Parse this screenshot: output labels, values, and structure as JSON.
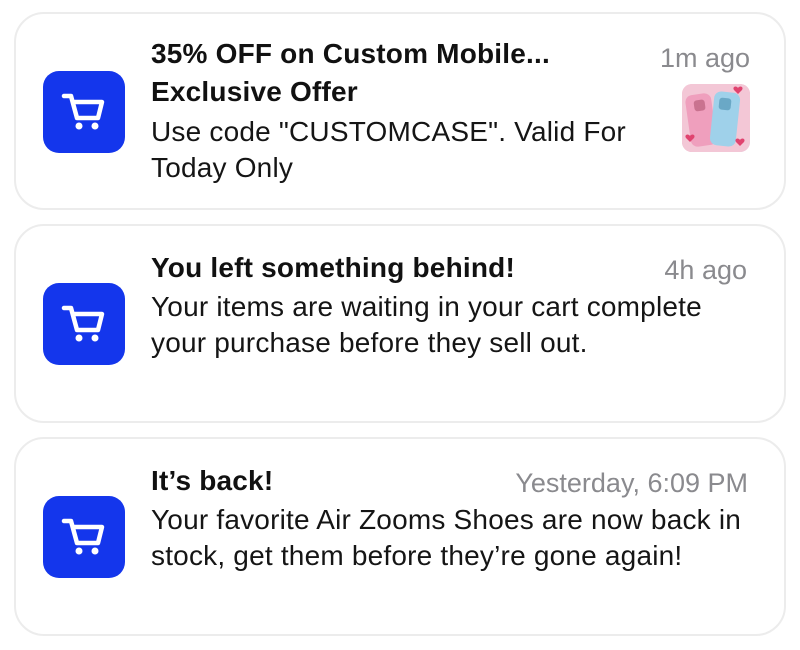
{
  "notifications": [
    {
      "app_icon": "shopping-cart-icon",
      "title": "35% OFF on Custom Mobile...",
      "subtitle": "Exclusive Offer",
      "body": "Use code \"CUSTOMCASE\". Valid For Today Only",
      "time": "1m ago",
      "thumbnail": "phone-cases-image"
    },
    {
      "app_icon": "shopping-cart-icon",
      "title": "You left something behind!",
      "body": "Your items are waiting in your cart complete your purchase before they sell out.",
      "time": "4h ago"
    },
    {
      "app_icon": "shopping-cart-icon",
      "title": "It’s back!",
      "body": "Your favorite Air Zooms Shoes are now back in stock, get them before they’re gone again!",
      "time": "Yesterday, 6:09 PM"
    }
  ],
  "colors": {
    "icon_background": "#1436ec",
    "time_text": "#8a8a8e",
    "card_border": "#ececec"
  }
}
